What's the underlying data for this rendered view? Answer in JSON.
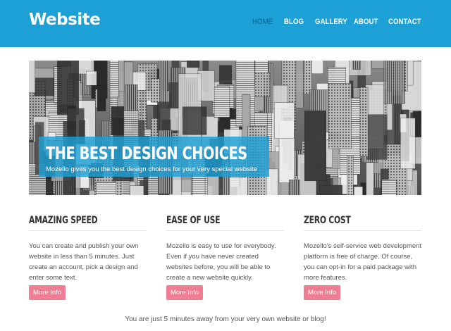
{
  "site": {
    "logo": "Website"
  },
  "nav": {
    "items": [
      {
        "label": "HOME",
        "active": true
      },
      {
        "label": "BLOG",
        "active": false
      },
      {
        "label": "GALLERY",
        "active": false
      },
      {
        "label": "ABOUT",
        "active": false
      },
      {
        "label": "CONTACT",
        "active": false
      }
    ]
  },
  "hero": {
    "title": "THE BEST DESIGN CHOICES",
    "subtitle": "Mozello gives you the best design choices for your very special website"
  },
  "features": [
    {
      "title": "AMAZING SPEED",
      "text": "You can create and publish your own website in less than 5 minutes. Just create an account, pick a design and enter some text.",
      "button": "More Info"
    },
    {
      "title": "EASE OF USE",
      "text": "Mozello is easy to use for everybody. Even if you have never created websites before, you will be able to create a new website quickly.",
      "button": "More Info"
    },
    {
      "title": "ZERO COST",
      "text": "Mozello's self-service web development platform is free of charge. Of course, you can opt-in for a paid package with more features.",
      "button": "More Info"
    }
  ],
  "footer": {
    "tagline": "You are just 5 minutes away from your very own website or blog!"
  },
  "colors": {
    "header": "#1da0d6",
    "nav_active": "#0d5f86",
    "button": "#f07e93",
    "banner": "#1da0d6"
  }
}
